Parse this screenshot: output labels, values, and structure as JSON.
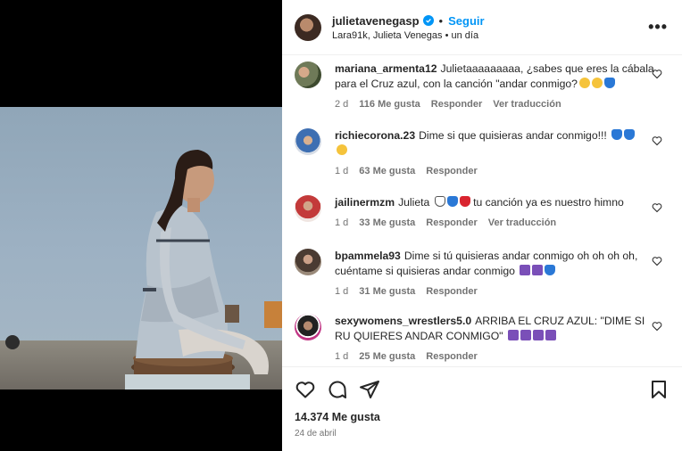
{
  "header": {
    "username": "julietavenegasp",
    "separator": "•",
    "follow_label": "Seguir",
    "subtitle": "Lara91k, Julieta Venegas • un día",
    "more_icon": "more-icon"
  },
  "comments": [
    {
      "user": "mariana_armenta12",
      "text": "Julietaaaaaaaaa, ¿sabes que eres la cábala para el Cruz azul, con la canción \"andar conmigo?",
      "emojis": [
        "face",
        "face",
        "blue"
      ],
      "time": "2 d",
      "likes": "116 Me gusta",
      "reply": "Responder",
      "translate": "Ver traducción"
    },
    {
      "user": "richiecorona.23",
      "text": "Dime si que quisieras andar conmigo!!!",
      "emojis": [
        "blue",
        "blue",
        "face"
      ],
      "time": "1 d",
      "likes": "63 Me gusta",
      "reply": "Responder"
    },
    {
      "user": "jailinermzm",
      "text_before": "Julieta",
      "text_after": "tu canción ya es nuestro himno",
      "emojis": [
        "white",
        "blue",
        "red"
      ],
      "time": "1 d",
      "likes": "33 Me gusta",
      "reply": "Responder",
      "translate": "Ver traducción"
    },
    {
      "user": "bpammela93",
      "text": "Dime si tú quisieras andar conmigo oh oh oh oh, cuéntame si quisieras andar conmigo",
      "emojis": [
        "purple",
        "purple",
        "blue"
      ],
      "time": "1 d",
      "likes": "31 Me gusta",
      "reply": "Responder"
    },
    {
      "user": "sexywomens_wrestlers5.0",
      "text": "ARRIBA EL CRUZ AZUL: \"DIME SI RU QUIERES ANDAR CONMIGO\"",
      "emojis": [
        "purple",
        "purple",
        "purple",
        "purple"
      ],
      "time": "1 d",
      "likes": "25 Me gusta",
      "reply": "Responder"
    }
  ],
  "footer": {
    "likes": "14.374 Me gusta",
    "date": "24 de abril"
  },
  "colors": {
    "accent": "#0095f6",
    "meta": "#737373"
  }
}
